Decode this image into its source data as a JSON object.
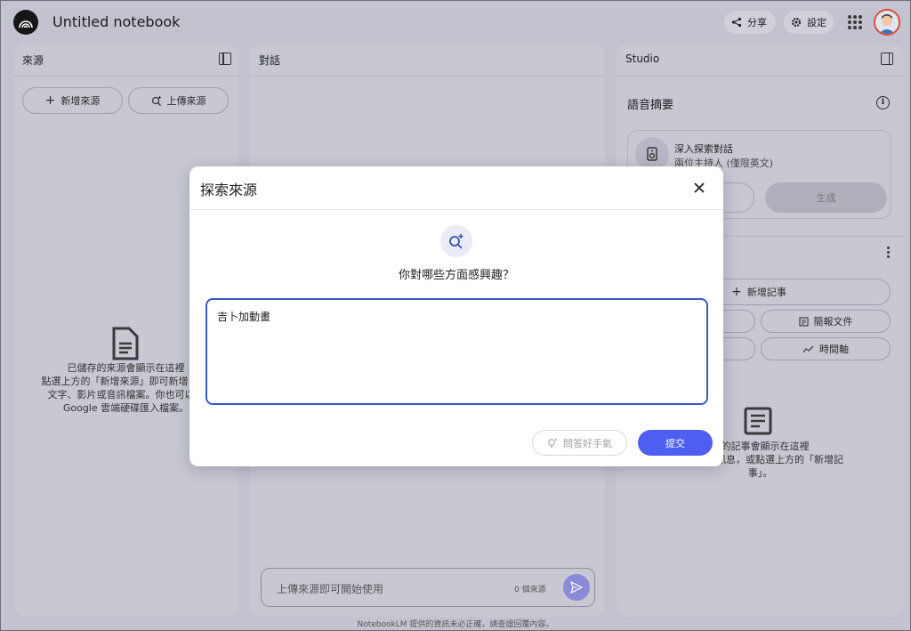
{
  "header": {
    "notebook_title": "Untitled notebook",
    "share_label": "分享",
    "settings_label": "設定"
  },
  "sources": {
    "title": "來源",
    "add_label": "新增來源",
    "upload_label": "上傳來源",
    "empty_lines": [
      "已儲存的來源會顯示在這裡",
      "點選上方的「新增來源」即可新增 PDF",
      "文字、影片或音訊檔案。你也可以直",
      "Google 雲端硬碟匯入檔案。"
    ]
  },
  "chat": {
    "title": "對話",
    "input_placeholder": "上傳來源即可開始使用",
    "source_count": "0 個來源"
  },
  "studio": {
    "title": "Studio",
    "audio_heading": "語音摘要",
    "info_glyph": "i",
    "card_title": "深入探索對話",
    "card_subtitle": "兩位主持人 (僅限英文)",
    "generate_label": "生成",
    "add_note_label": "新增記事",
    "brief_doc_label": "簡報文件",
    "timeline_label": "時間軸",
    "notes_empty_lines": [
      "存的記事會顯示在這裡",
      "儲存對話訊息，或點選上方的「新增記",
      "事」。"
    ]
  },
  "footer": {
    "disclaimer": "NotebookLM 提供的資訊未必正確，請查證回覆內容。"
  },
  "modal": {
    "title": "探索來源",
    "question": "你對哪些方面感興趣？",
    "input_value": "吉卜加動畫",
    "lucky_label": "問答好手氣",
    "submit_label": "提交"
  },
  "colors": {
    "accent": "#4e5ef0",
    "input_border": "#3a57c4",
    "overlay": "#c3c3cf"
  }
}
